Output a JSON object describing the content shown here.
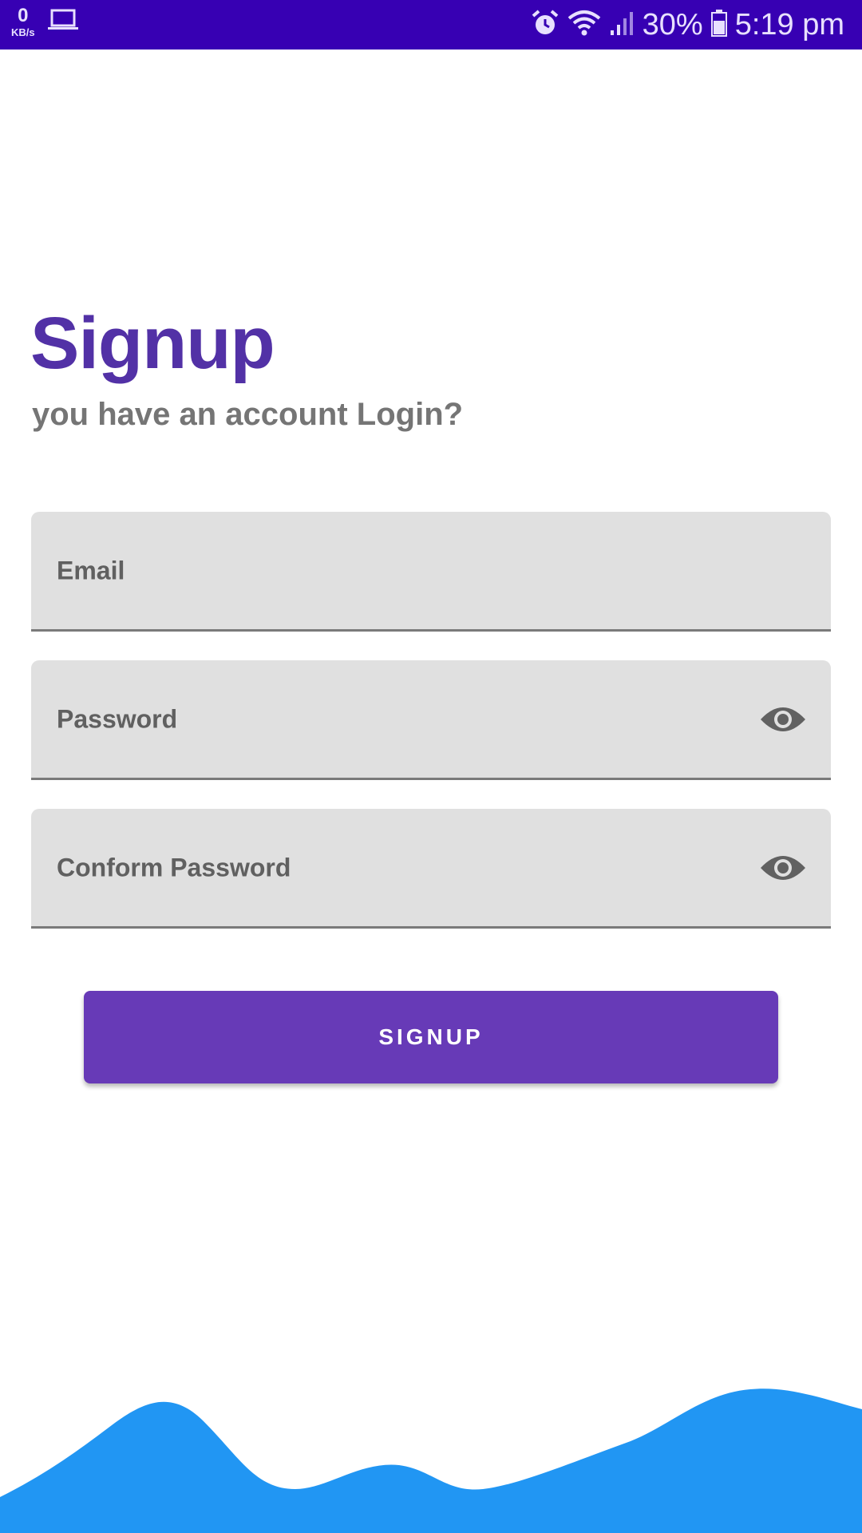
{
  "status_bar": {
    "net_speed_value": "0",
    "net_speed_unit": "KB/s",
    "battery": "30%",
    "time": "5:19 pm"
  },
  "page": {
    "title": "Signup",
    "subtitle": "you have an account Login?"
  },
  "form": {
    "email_label": "Email",
    "password_label": "Password",
    "confirm_password_label": "Conform Password",
    "submit_label": "SIGNUP"
  },
  "colors": {
    "status_bar": "#3700B3",
    "title": "#5231A6",
    "button": "#673AB7",
    "field_bg": "#E0E0E0",
    "wave": "#2196F3"
  }
}
